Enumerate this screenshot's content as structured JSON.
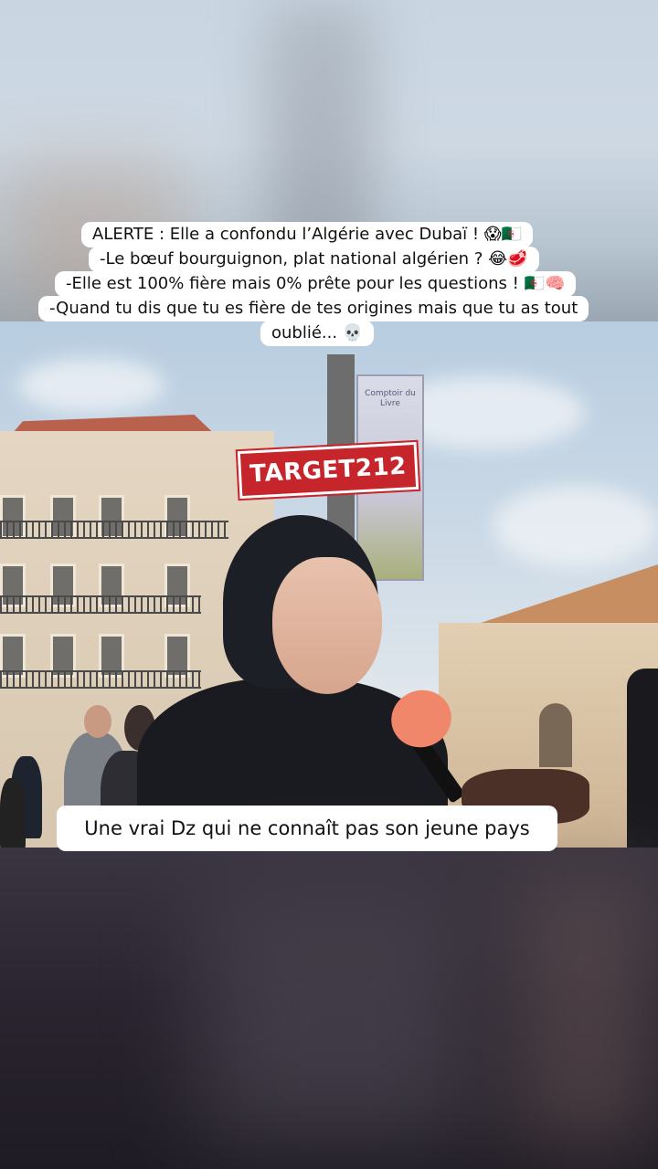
{
  "overlay": {
    "caption_lines": [
      "ALERTE : Elle a confondu l’Algérie avec Dubaï ! 😱🇩🇿",
      "-Le bœuf bourguignon, plat national algérien ? 😂🥩",
      "-Elle est 100% fière mais 0% prête pour les questions ! 🇩🇿🧠",
      "-Quand tu dis que tu es fière de tes origines mais que tu as tout",
      "oublié... 💀"
    ],
    "watermark_stamp": "TARGET212",
    "banner_text": "Comptoir du Livre",
    "subtitle": "Une vrai Dz qui ne connaît pas son jeune pays"
  }
}
